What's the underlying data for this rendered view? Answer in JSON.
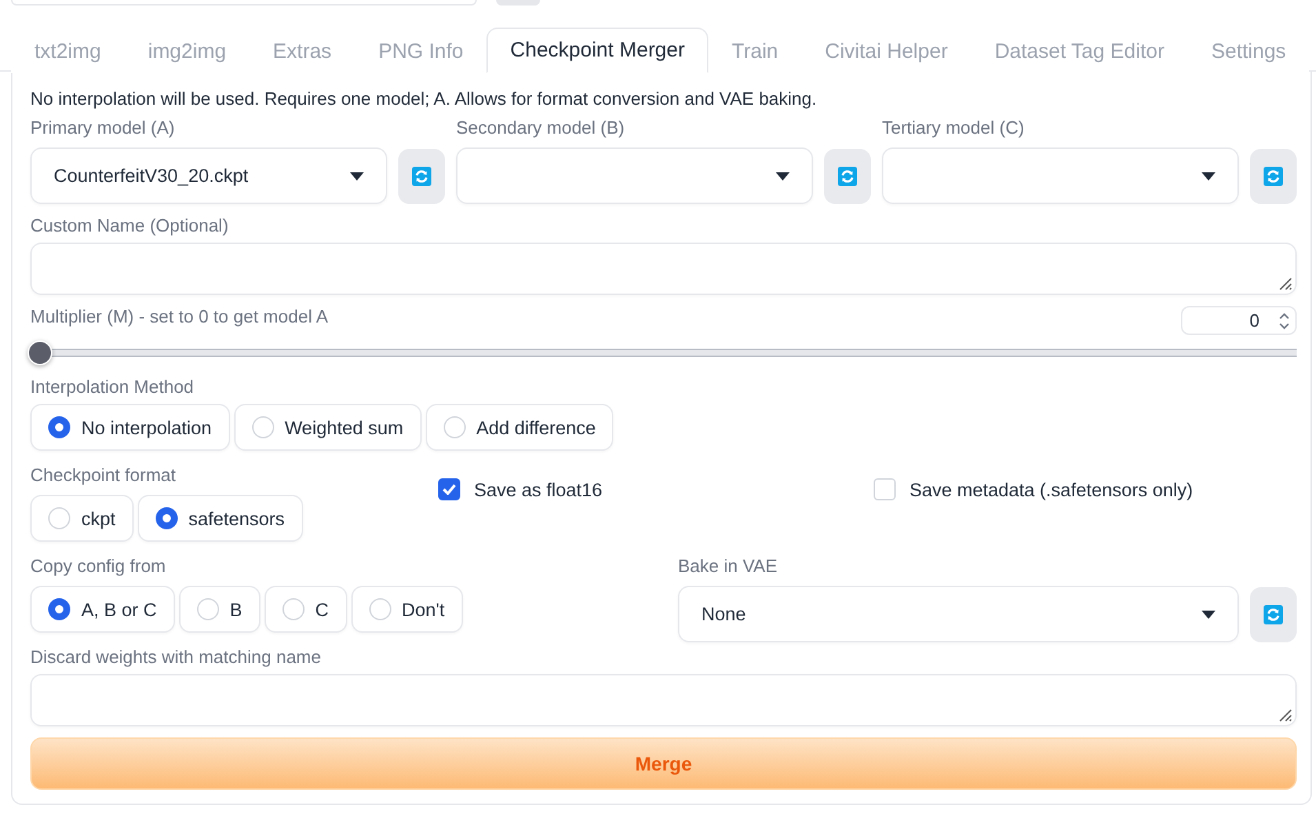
{
  "tabs": [
    {
      "label": "txt2img",
      "selected": false
    },
    {
      "label": "img2img",
      "selected": false
    },
    {
      "label": "Extras",
      "selected": false
    },
    {
      "label": "PNG Info",
      "selected": false
    },
    {
      "label": "Checkpoint Merger",
      "selected": true
    },
    {
      "label": "Train",
      "selected": false
    },
    {
      "label": "Civitai Helper",
      "selected": false
    },
    {
      "label": "Dataset Tag Editor",
      "selected": false
    },
    {
      "label": "Settings",
      "selected": false
    }
  ],
  "description": "No interpolation will be used. Requires one model; A. Allows for format conversion and VAE baking.",
  "models": [
    {
      "label": "Primary model (A)",
      "value": "CounterfeitV30_20.ckpt"
    },
    {
      "label": "Secondary model (B)"
    },
    {
      "label": "Tertiary model (C)"
    }
  ],
  "custom_name": {
    "label": "Custom Name (Optional)"
  },
  "multiplier": {
    "label": "Multiplier (M) - set to 0 to get model A",
    "value": "0",
    "level": 0
  },
  "interpolation": {
    "label": "Interpolation Method",
    "options": [
      {
        "label": "No interpolation",
        "selected": true
      },
      {
        "label": "Weighted sum",
        "selected": false
      },
      {
        "label": "Add difference",
        "selected": false
      }
    ]
  },
  "checkpoint_format": {
    "label": "Checkpoint format",
    "options": [
      {
        "label": "ckpt",
        "selected": false
      },
      {
        "label": "safetensors",
        "selected": true
      }
    ]
  },
  "save_float16": {
    "label": "Save as float16",
    "checked": true
  },
  "save_metadata": {
    "label": "Save metadata (.safetensors only)",
    "checked": false
  },
  "copy_config": {
    "label": "Copy config from",
    "options": [
      {
        "label": "A, B or C",
        "selected": true
      },
      {
        "label": "B",
        "selected": false
      },
      {
        "label": "C",
        "selected": false
      },
      {
        "label": "Don't",
        "selected": false
      }
    ]
  },
  "bake_vae": {
    "label": "Bake in VAE",
    "value": "None"
  },
  "discard_weights": {
    "label": "Discard weights with matching name"
  },
  "merge_button": "Merge"
}
